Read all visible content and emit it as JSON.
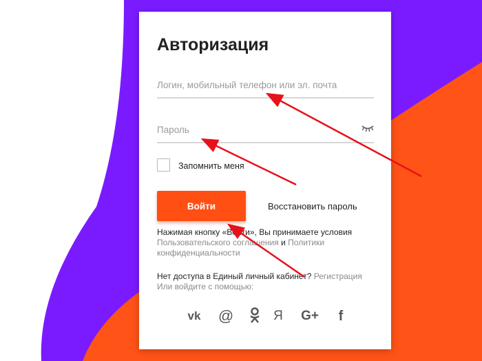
{
  "form": {
    "title": "Авторизация",
    "login_placeholder": "Логин, мобильный телефон или эл. почта",
    "password_placeholder": "Пароль",
    "remember_label": "Запомнить меня",
    "login_button": "Войти",
    "restore_link": "Восстановить пароль",
    "terms_prefix": "Нажимая кнопку «Войти», Вы принимаете условия",
    "terms_link1": "Пользовательского соглашения",
    "terms_and": " и ",
    "terms_link2": "Политики конфиденциальности",
    "no_access_text": "Нет доступа в Единый личный кабинет? ",
    "register_link": "Регистрация",
    "social_prompt": "Или войдите с помощью:"
  },
  "social": {
    "vk": "vk",
    "mail": "@",
    "ok": "ok",
    "yandex": "Я",
    "google": "G+",
    "facebook": "f"
  },
  "colors": {
    "accent": "#ff4f12",
    "purple": "#7a1bff",
    "orange": "#ff5317",
    "arrow": "#e8101a"
  },
  "icons": [
    "eye-closed-icon",
    "vk-icon",
    "mail-at-icon",
    "odnoklassniki-icon",
    "yandex-icon",
    "google-plus-icon",
    "facebook-icon"
  ]
}
